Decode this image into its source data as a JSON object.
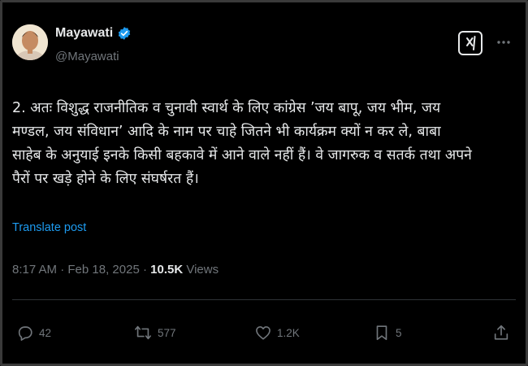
{
  "author": {
    "name": "Mayawati",
    "handle": "@Mayawati",
    "verified": true
  },
  "tweet": {
    "text": "2. अतः विशुद्ध राजनीतिक व चुनावी स्वार्थ के लिए कांग्रेस ’जय बापू, जय भीम, जय\nमण्डल, जय संविधान’ आदि के नाम पर चाहे जितने भी कार्यक्रम क्यों न कर ले, बाबा\nसाहेब के अनुयाई इनके किसी बहकावे में आने वाले नहीं हैं। वे जागरुक व सतर्क तथा अपने\nपैरों पर खड़े होने के लिए संघर्षरत हैं।",
    "translate_label": "Translate post"
  },
  "meta": {
    "time": "8:17 AM",
    "separator1": " · ",
    "date": "Feb 18, 2025",
    "separator2": " · ",
    "views_count": "10.5K",
    "views_label": " Views"
  },
  "actions": {
    "replies": "42",
    "reposts": "577",
    "likes": "1.2K",
    "bookmarks": "5"
  },
  "icons": {
    "verified": "verified-badge-icon",
    "grok": "grok-icon",
    "more": "more-options-icon",
    "reply": "reply-icon",
    "repost": "repost-icon",
    "like": "like-icon",
    "bookmark": "bookmark-icon",
    "share": "share-icon"
  },
  "colors": {
    "background": "#000000",
    "text": "#e7e9ea",
    "muted": "#71767b",
    "accent": "#1d9bf0"
  }
}
